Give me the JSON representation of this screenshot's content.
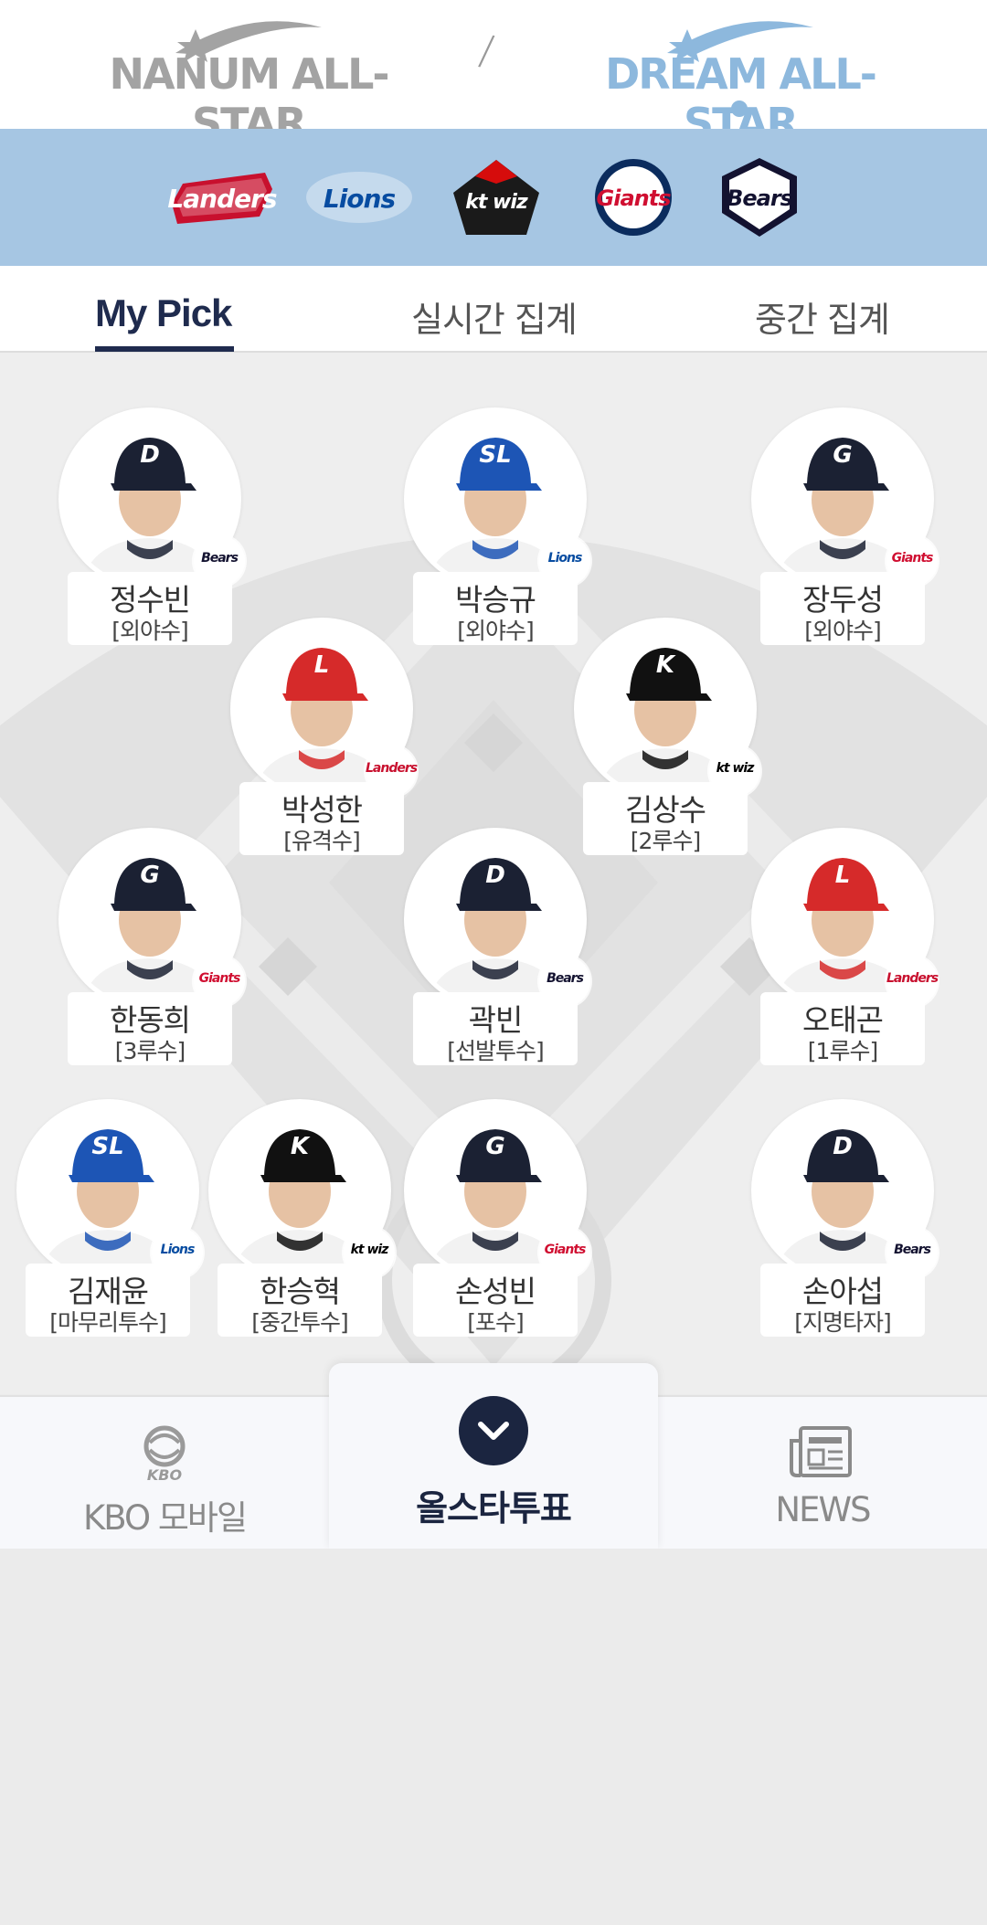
{
  "header": {
    "left_logo": "NANUM ALL-STAR",
    "divider": "/",
    "right_logo": "DREAM ALL-STAR"
  },
  "teams": [
    {
      "name": "Landers",
      "icon": "landers-logo",
      "color": "#c8102e"
    },
    {
      "name": "Lions",
      "icon": "lions-logo",
      "color": "#074ca1"
    },
    {
      "name": "kt wiz",
      "icon": "ktwiz-logo",
      "color": "#000000"
    },
    {
      "name": "Giants",
      "icon": "giants-logo",
      "color": "#d00f31"
    },
    {
      "name": "Bears",
      "icon": "bears-logo",
      "color": "#131230"
    }
  ],
  "tabs": [
    {
      "label": "My Pick",
      "active": true
    },
    {
      "label": "실시간 집계",
      "active": false
    },
    {
      "label": "중간 집계",
      "active": false
    }
  ],
  "players": [
    {
      "name": "정수빈",
      "position": "[외야수]",
      "team": "Bears",
      "cap": "#1b2133",
      "cap_logo": "D"
    },
    {
      "name": "박승규",
      "position": "[외야수]",
      "team": "Lions",
      "cap": "#1d55b5",
      "cap_logo": "SL"
    },
    {
      "name": "장두성",
      "position": "[외야수]",
      "team": "Giants",
      "cap": "#1b2133",
      "cap_logo": "G"
    },
    {
      "name": "박성한",
      "position": "[유격수]",
      "team": "Landers",
      "cap": "#d62a2a",
      "cap_logo": "L"
    },
    {
      "name": "김상수",
      "position": "[2루수]",
      "team": "kt wiz",
      "cap": "#111111",
      "cap_logo": "K"
    },
    {
      "name": "한동희",
      "position": "[3루수]",
      "team": "Giants",
      "cap": "#1b2133",
      "cap_logo": "G"
    },
    {
      "name": "곽빈",
      "position": "[선발투수]",
      "team": "Bears",
      "cap": "#1b2133",
      "cap_logo": "D"
    },
    {
      "name": "오태곤",
      "position": "[1루수]",
      "team": "Landers",
      "cap": "#d62a2a",
      "cap_logo": "L"
    },
    {
      "name": "김재윤",
      "position": "[마무리투수]",
      "team": "Lions",
      "cap": "#1d55b5",
      "cap_logo": "SL"
    },
    {
      "name": "한승혁",
      "position": "[중간투수]",
      "team": "kt wiz",
      "cap": "#111111",
      "cap_logo": "K"
    },
    {
      "name": "손성빈",
      "position": "[포수]",
      "team": "Giants",
      "cap": "#1b2133",
      "cap_logo": "G"
    },
    {
      "name": "손아섭",
      "position": "[지명타자]",
      "team": "Bears",
      "cap": "#1b2133",
      "cap_logo": "D"
    }
  ],
  "bottom_nav": {
    "kbo_icon_text": "KBO",
    "kbo_label": "KBO 모바일",
    "vote_label": "올스타투표",
    "news_label": "NEWS"
  },
  "colors": {
    "navy": "#1f2b4e",
    "strip": "#a6c6e3",
    "dream": "#8db8dd"
  }
}
